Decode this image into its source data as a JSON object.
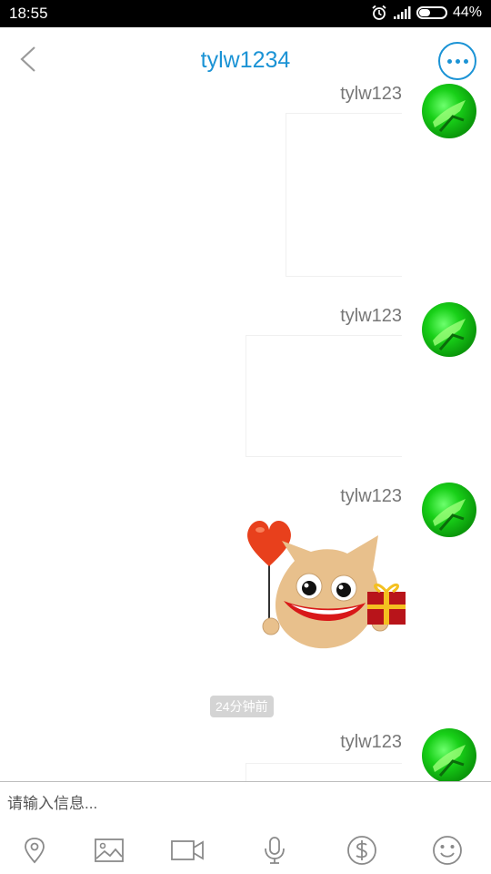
{
  "status_bar": {
    "time": "18:55",
    "battery_percent": "44%",
    "battery_level": 0.44
  },
  "header": {
    "title": "tylw1234"
  },
  "messages": [
    {
      "sender": "tylw123"
    },
    {
      "sender": "tylw123"
    },
    {
      "sender": "tylw123"
    },
    {
      "sender": "tylw123"
    }
  ],
  "timestamp": "24分钟前",
  "input": {
    "placeholder": "请输入信息..."
  },
  "toolbar": {
    "icons": [
      "location-icon",
      "image-icon",
      "video-icon",
      "microphone-icon",
      "money-icon",
      "emoji-icon"
    ]
  },
  "colors": {
    "accent": "#1b93d5",
    "avatar_green": "#18d018",
    "toolbar_icon": "#8a8a8a"
  }
}
